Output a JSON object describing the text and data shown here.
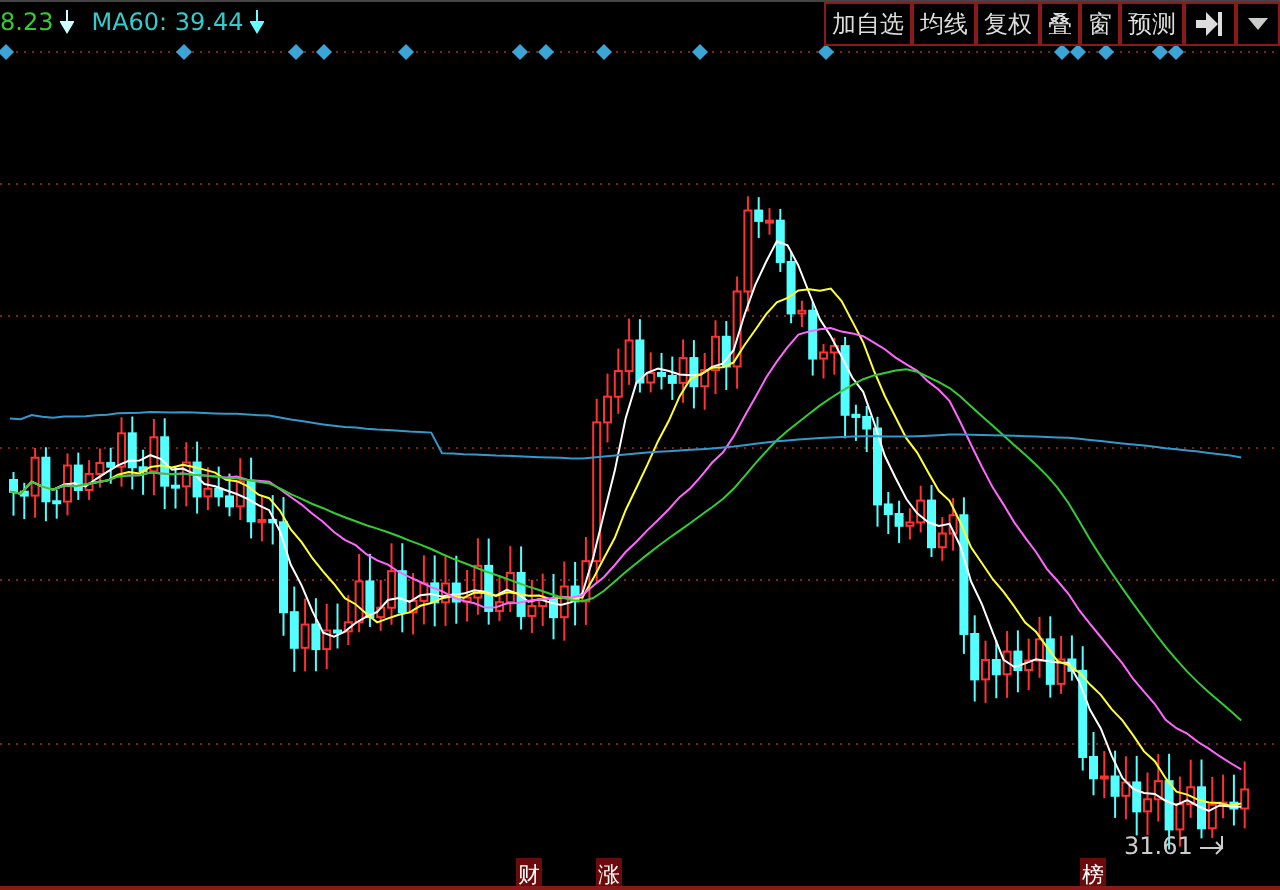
{
  "legend": [
    {
      "text": "8.23",
      "color": "#33cc33"
    },
    {
      "text": "MA60: 39.44",
      "color": "#33cccc"
    }
  ],
  "toolbar": [
    "加自选",
    "均线",
    "复权",
    "叠",
    "窗",
    "预测"
  ],
  "low_label": "31.61",
  "event_markers": [
    "财",
    "涨",
    "榜"
  ]
}
